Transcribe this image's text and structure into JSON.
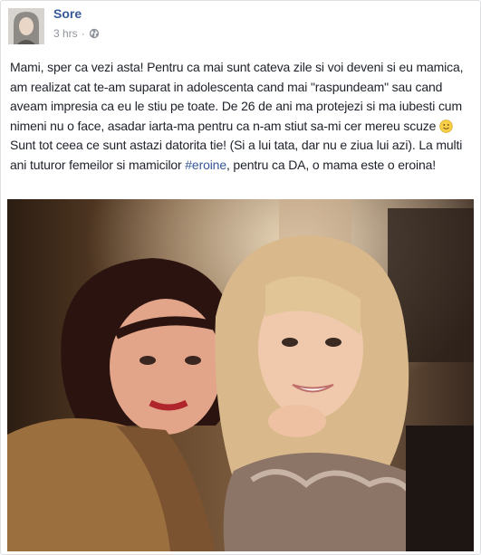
{
  "post": {
    "author": "Sore",
    "time": "3 hrs",
    "separator": "·",
    "privacy_icon": "globe-icon",
    "avatar_icon": "profile-avatar",
    "text_parts": [
      "Mami, sper ca vezi asta! Pentru ca mai sunt cateva zile si voi deveni si eu mamica, am realizat cat te-am suparat in adolescenta cand mai \"raspundeam\" sau cand aveam impresia ca eu le stiu pe toate. De 26 de ani ma protejezi si ma iubesti cum nimeni nu o face, asadar iarta-ma pentru ca n-am stiut sa-mi cer mereu scuze",
      " Sunt tot ceea ce sunt astazi datorita tie! (Si a lui tata, dar nu e ziua lui azi). La multi ani tuturor femeilor si mamicilor ",
      "#eroine",
      ", pentru ca DA, o mama este o eroina!"
    ],
    "emoji_icon": "smiley-emoji-icon",
    "photo_icon": "selfie-photo",
    "colors": {
      "author": "#365899",
      "meta": "#90949c",
      "text": "#1d2129",
      "hashtag": "#365899"
    }
  }
}
